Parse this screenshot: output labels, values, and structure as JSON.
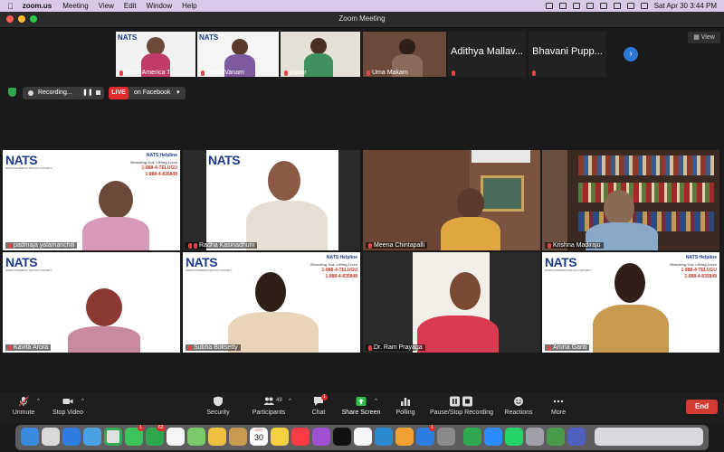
{
  "menubar": {
    "app": "zoom.us",
    "menus": [
      "Meeting",
      "View",
      "Edit",
      "Window",
      "Help"
    ],
    "datetime": "Sat Apr 30  3:44 PM"
  },
  "window": {
    "title": "Zoom Meeting"
  },
  "view_button": "View",
  "thumbnails": [
    {
      "name": "North America T...",
      "muted": true
    },
    {
      "name": "Jyothi Vanam",
      "muted": true
    },
    {
      "name": "jayasr",
      "muted": true
    },
    {
      "name": "Uma Makam",
      "muted": true
    },
    {
      "name": "Adithya Mallav...",
      "muted": true
    },
    {
      "name": "Bhavani Pupp...",
      "muted": true
    }
  ],
  "recording": {
    "label": "Recording...",
    "live_badge": "LIVE",
    "live_target": "on Facebook"
  },
  "helpline": {
    "title": "NATS Helpline",
    "tagline": "Reaching Out, Lifting Lives",
    "phone1": "1-888-4-TELUGU",
    "phone2": "1-888-4-835848"
  },
  "logo": {
    "text": "NATS",
    "sub": "NORTH AMERICA TELUGU SOCIETY"
  },
  "participants_grid": [
    {
      "name": "padmaja yalamanchili"
    },
    {
      "name": "Radha Kasinadhuni"
    },
    {
      "name": "Meena Chintapalli"
    },
    {
      "name": "Krishna Madiraju"
    },
    {
      "name": "Kavita Arora"
    },
    {
      "name": "Subha Bolisetty"
    },
    {
      "name": "Dr. Ram Prayaga"
    },
    {
      "name": "Aruna Ganti"
    }
  ],
  "toolbar": {
    "unmute": "Unmute",
    "stop_video": "Stop Video",
    "security": "Security",
    "participants": "Participants",
    "participants_count": "49",
    "chat": "Chat",
    "chat_badge": "1",
    "share_screen": "Share Screen",
    "polling": "Polling",
    "pause_stop_recording": "Pause/Stop Recording",
    "reactions": "Reactions",
    "more": "More",
    "end": "End"
  },
  "dock": {
    "calendar_day": "30",
    "calendar_month": "APR",
    "mail_badge": "1",
    "messages_badge": "1",
    "facetime_badge": "62",
    "appstore_badge": "1"
  },
  "colors": {
    "accent_share": "#2fbf4a",
    "end": "#d43b33",
    "live": "#e02b2b",
    "next": "#2a76d9"
  }
}
